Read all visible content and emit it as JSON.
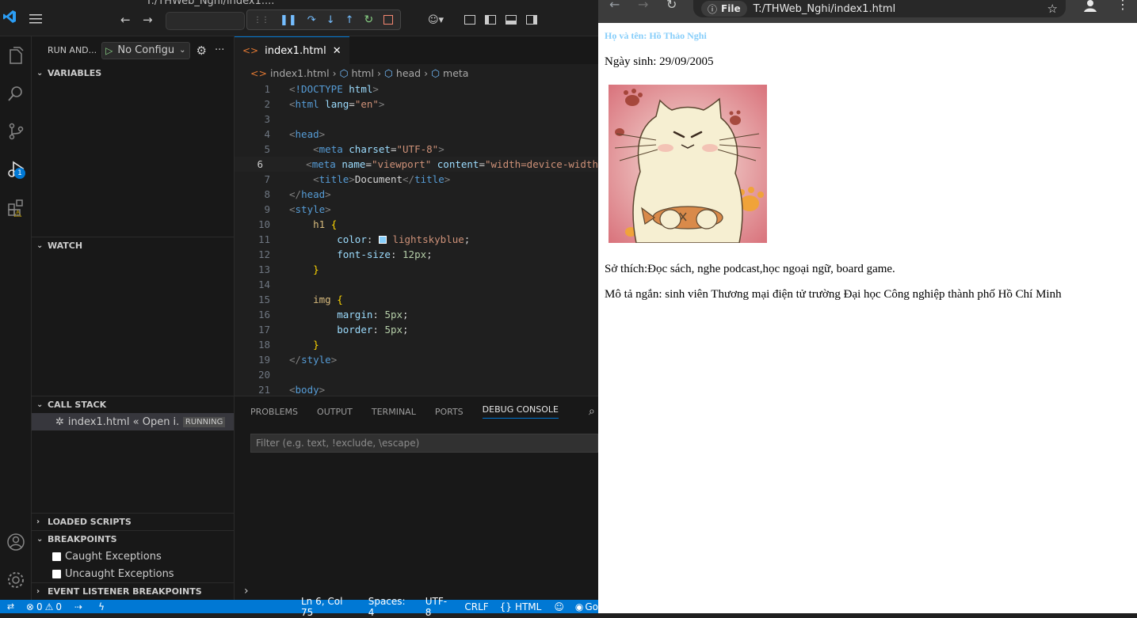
{
  "vscode": {
    "title_fragment": "T:/THWeb_Nghi/index1....",
    "run_label": "RUN AND...",
    "config": "No Configu",
    "sections": {
      "variables": "VARIABLES",
      "watch": "WATCH",
      "callstack": "CALL STACK",
      "loaded": "LOADED SCRIPTS",
      "breakpoints": "BREAKPOINTS",
      "event": "EVENT LISTENER BREAKPOINTS"
    },
    "callstack_item": "index1.html « Open i...",
    "callstack_badge": "RUNNING",
    "bp_caught": "Caught Exceptions",
    "bp_uncaught": "Uncaught Exceptions",
    "debug_badge": "1",
    "tab_label": "index1.html",
    "crumbs": [
      "index1.html",
      "html",
      "head",
      "meta"
    ],
    "panel_tabs": [
      "PROBLEMS",
      "OUTPUT",
      "TERMINAL",
      "PORTS",
      "DEBUG CONSOLE"
    ],
    "filter_placeholder": "Filter (e.g. text, !exclude, \\escape)",
    "status": {
      "errors": "0",
      "warnings": "0",
      "position": "Ln 6, Col 75",
      "spaces": "Spaces: 4",
      "encoding": "UTF-8",
      "eol": "CRLF",
      "lang": "HTML",
      "go": "Go"
    },
    "accent": "#0078d4"
  },
  "browser": {
    "file_chip": "File",
    "url": "T:/THWeb_Nghi/index1.html",
    "name_line": "Họ và tên: Hồ Thảo Nghi",
    "dob_line": "Ngày sinh: 29/09/2005",
    "hobby_line": "Sở thích:Đọc sách, nghe podcast,học ngoại ngữ, board game.",
    "desc_line": "Mô tả ngắn: sinh viên Thương mại điện tử trường Đại học Công nghiệp thành phố Hồ Chí Minh",
    "name_color": "#87cefa"
  }
}
